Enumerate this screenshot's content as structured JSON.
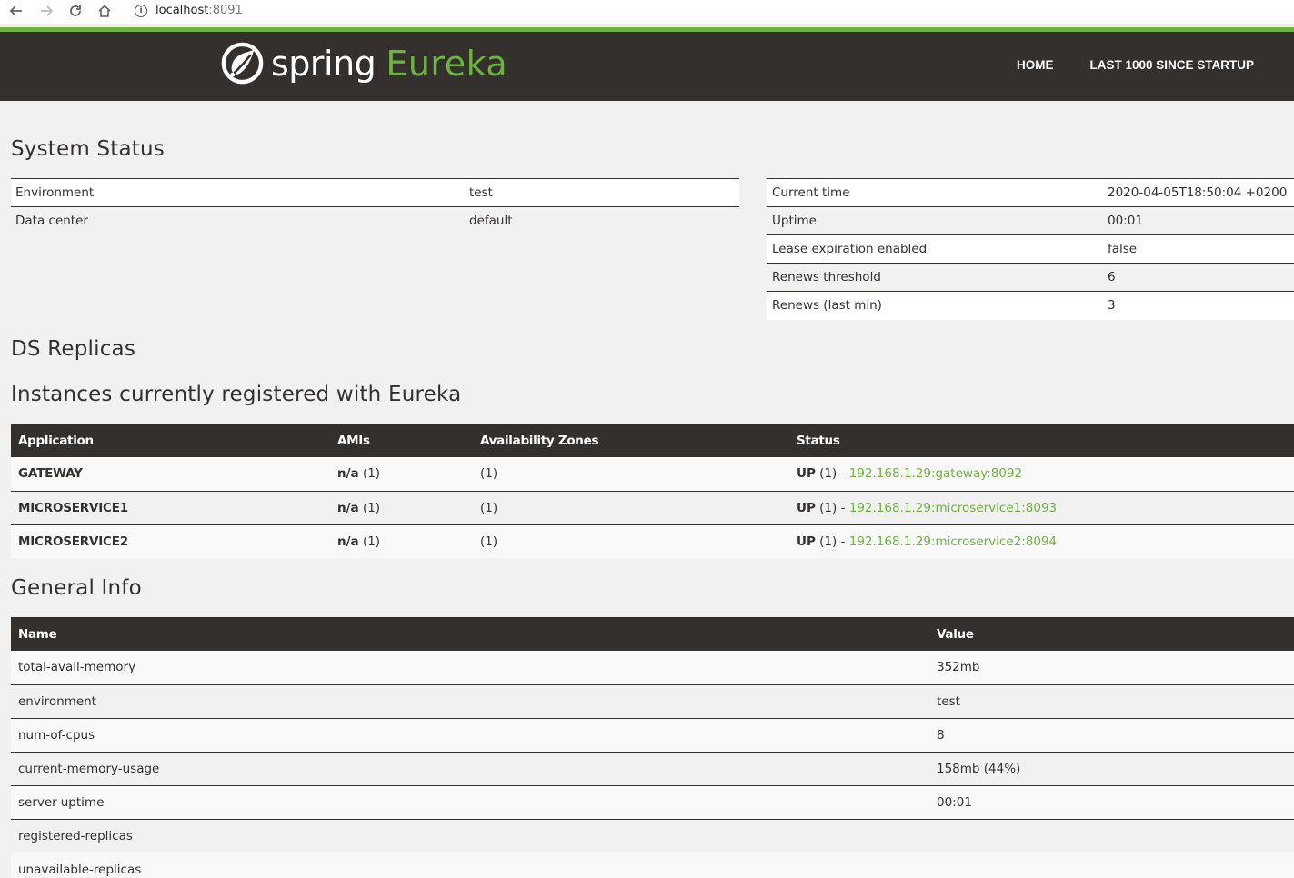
{
  "browser": {
    "url_host": "localhost",
    "url_port": ":8091"
  },
  "header": {
    "logo_spring": "spring",
    "logo_eureka": "Eureka",
    "nav": [
      {
        "label": "HOME"
      },
      {
        "label": "LAST 1000 SINCE STARTUP"
      }
    ]
  },
  "system_status": {
    "title": "System Status",
    "left": [
      {
        "label": "Environment",
        "value": "test"
      },
      {
        "label": "Data center",
        "value": "default"
      }
    ],
    "right": [
      {
        "label": "Current time",
        "value": "2020-04-05T18:50:04 +0200"
      },
      {
        "label": "Uptime",
        "value": "00:01"
      },
      {
        "label": "Lease expiration enabled",
        "value": "false"
      },
      {
        "label": "Renews threshold",
        "value": "6"
      },
      {
        "label": "Renews (last min)",
        "value": "3"
      }
    ]
  },
  "ds_replicas": {
    "title": "DS Replicas"
  },
  "instances": {
    "title": "Instances currently registered with Eureka",
    "headers": [
      "Application",
      "AMIs",
      "Availability Zones",
      "Status"
    ],
    "rows": [
      {
        "app": "GATEWAY",
        "ami_bold": "n/a",
        "ami_count": " (1)",
        "zones": "(1)",
        "status_bold": "UP",
        "status_count": " (1) - ",
        "link": "192.168.1.29:gateway:8092"
      },
      {
        "app": "MICROSERVICE1",
        "ami_bold": "n/a",
        "ami_count": " (1)",
        "zones": "(1)",
        "status_bold": "UP",
        "status_count": " (1) - ",
        "link": "192.168.1.29:microservice1:8093"
      },
      {
        "app": "MICROSERVICE2",
        "ami_bold": "n/a",
        "ami_count": " (1)",
        "zones": "(1)",
        "status_bold": "UP",
        "status_count": " (1) - ",
        "link": "192.168.1.29:microservice2:8094"
      }
    ]
  },
  "general_info": {
    "title": "General Info",
    "headers": [
      "Name",
      "Value"
    ],
    "rows": [
      {
        "name": "total-avail-memory",
        "value": "352mb"
      },
      {
        "name": "environment",
        "value": "test"
      },
      {
        "name": "num-of-cpus",
        "value": "8"
      },
      {
        "name": "current-memory-usage",
        "value": "158mb (44%)"
      },
      {
        "name": "server-uptime",
        "value": "00:01"
      },
      {
        "name": "registered-replicas",
        "value": ""
      },
      {
        "name": "unavailable-replicas",
        "value": ""
      }
    ]
  },
  "colors": {
    "brand_green": "#6db33f",
    "header_dark": "#34302d"
  }
}
